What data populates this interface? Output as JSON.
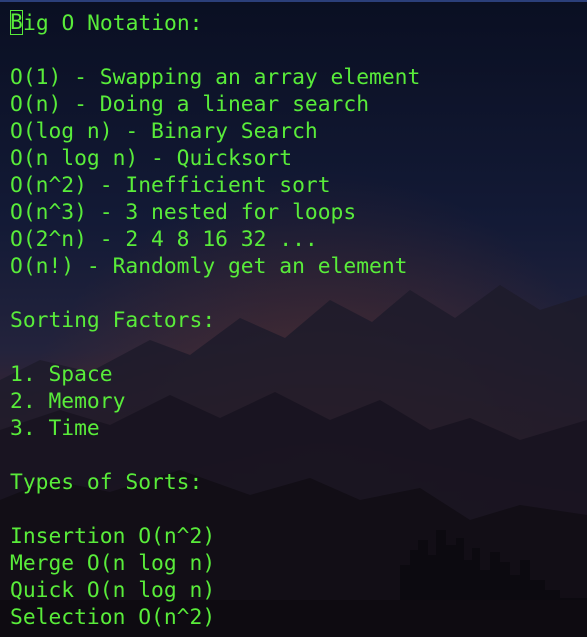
{
  "colors": {
    "text": "#59ec3a",
    "sky_top": "#0b1024",
    "sky_mid": "#1c2240",
    "horizon_glow": "#6a2a1c",
    "mountains": "#120f16",
    "city": "#0e0b12"
  },
  "terminal": {
    "cursor_char": "B",
    "first_line_rest": "ig O Notation:",
    "lines": [
      "",
      "O(1) - Swapping an array element",
      "O(n) - Doing a linear search",
      "O(log n) - Binary Search",
      "O(n log n) - Quicksort",
      "O(n^2) - Inefficient sort",
      "O(n^3) - 3 nested for loops",
      "O(2^n) - 2 4 8 16 32 ...",
      "O(n!) - Randomly get an element",
      "",
      "Sorting Factors:",
      "",
      "1. Space",
      "2. Memory",
      "3. Time",
      "",
      "Types of Sorts:",
      "",
      "Insertion O(n^2)",
      "Merge O(n log n)",
      "Quick O(n log n)",
      "Selection O(n^2)"
    ]
  }
}
